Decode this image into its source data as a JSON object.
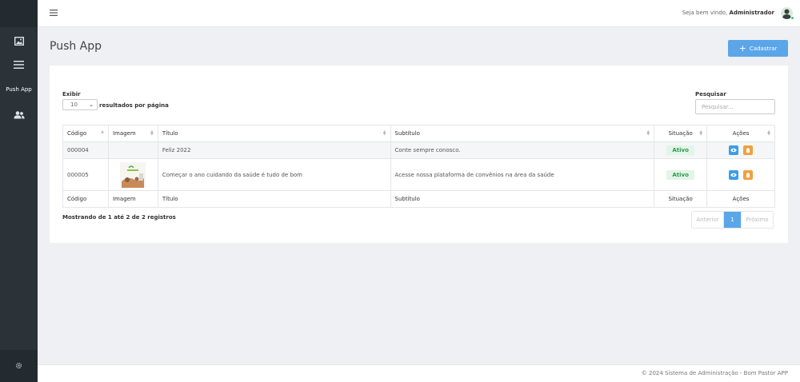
{
  "sidebar": {
    "items": [
      {
        "icon": "image-icon"
      },
      {
        "icon": "menu-icon"
      },
      {
        "label": "Push App"
      },
      {
        "icon": "users-icon"
      }
    ],
    "bottom_icon": "gear-icon"
  },
  "topbar": {
    "welcome_prefix": "Seja bem vindo,",
    "welcome_user": "Administrador"
  },
  "page": {
    "title": "Push App",
    "add_button": "Cadastrar"
  },
  "table_controls": {
    "length_label": "Exibir",
    "length_value": "10",
    "length_suffix": "resultados por página",
    "search_label": "Pesquisar",
    "search_placeholder": "Pesquisar..."
  },
  "table": {
    "columns": [
      "Código",
      "Imagem",
      "Título",
      "Subtítulo",
      "Situação",
      "Ações"
    ],
    "rows": [
      {
        "codigo": "000004",
        "titulo": "Feliz 2022",
        "subtitulo": "Conte sempre conosco.",
        "situacao": "Ativo"
      },
      {
        "codigo": "000005",
        "titulo": "Começar o ano cuidando da saúde é tudo de bom",
        "subtitulo": "Acesse nossa plataforma de convênios na área da saúde",
        "situacao": "Ativo"
      }
    ]
  },
  "pagination": {
    "info": "Mostrando de 1 até 2 de 2 registros",
    "prev": "Anterior",
    "current": "1",
    "next": "Próximo"
  },
  "footer": {
    "text": "© 2024 Sistema de Administração - Bom Pastor APP"
  },
  "colors": {
    "sidebar": "#2b3338",
    "primary": "#5aa6e8",
    "active_badge": "#2a9d4b",
    "view_button": "#3b9ee6",
    "notify_button": "#f2a03d"
  }
}
